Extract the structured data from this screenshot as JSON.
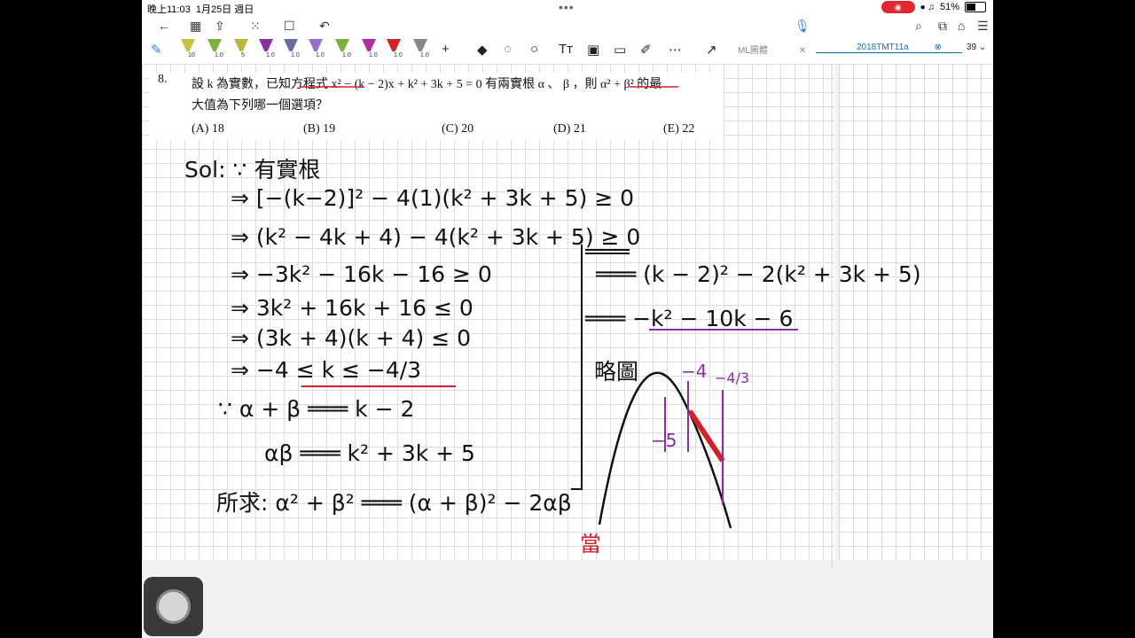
{
  "status": {
    "time": "晚上11:03",
    "date": "1月25日 週日",
    "battery": "51%"
  },
  "toolbar": {
    "pen_sizes": [
      "10",
      "1.0",
      "5",
      "1.0",
      "1.0",
      "1.0",
      "1.0",
      "1.0",
      "1.0",
      "1.0"
    ],
    "pen_colors": [
      "#c9c23a",
      "#7bb33a",
      "#b8b83a",
      "#8a2f9e",
      "#6c6c9a",
      "#9a6cc9",
      "#7bb33a",
      "#b02fa0",
      "#d0202a",
      "#888888"
    ]
  },
  "tabs": [
    {
      "label": "ML圖體"
    },
    {
      "label": "2018TMT11a"
    }
  ],
  "page_count": "39",
  "question": {
    "number": "8.",
    "line1": "設 k 為實數，已知方程式 x² − (k − 2)x + k² + 3k + 5 = 0 有兩實根 α 、 β ，則 α² + β² 的最",
    "line2": "大值為下列哪一個選項？",
    "options": [
      "(A)  18",
      "(B)  19",
      "(C)  20",
      "(D)  21",
      "(E)  22"
    ]
  },
  "handwriting": {
    "sol": "Sol: ∵ 有實根",
    "step1": "⇒ [−(k−2)]² − 4(1)(k² + 3k + 5) ≥ 0",
    "step2": "⇒ (k² − 4k + 4) − 4(k² + 3k + 5) ≥ 0",
    "step3": "⇒ −3k² − 16k − 16 ≥ 0",
    "step4": "⇒ 3k² + 16k + 16 ≤ 0",
    "step5": "⇒ (3k + 4)(k + 4) ≤ 0",
    "step6": "⇒ −4 ≤ k ≤ −4/3",
    "sum": "∵ α + β ═══ k − 2",
    "product": "αβ ═══ k² + 3k + 5",
    "target": "所求: α² + β² ═══ (α + β)² − 2αβ",
    "r1": "═══ (k − 2)² − 2(k² + 3k + 5)",
    "r2": "═══ −k² − 10k − 6",
    "graph_title": "略圖",
    "m4": "−4",
    "m43": "−4/3",
    "m5": "−5",
    "when": "當"
  }
}
